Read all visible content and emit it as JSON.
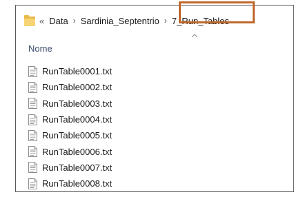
{
  "address_bar": {
    "overflow": "«",
    "path": [
      "Data",
      "Sardinia_Septentrio",
      "7_Run_Tables"
    ],
    "separator": "›"
  },
  "column_header": "Nome",
  "files": [
    {
      "name": "RunTable0001.txt"
    },
    {
      "name": "RunTable0002.txt"
    },
    {
      "name": "RunTable0003.txt"
    },
    {
      "name": "RunTable0004.txt"
    },
    {
      "name": "RunTable0005.txt"
    },
    {
      "name": "RunTable0006.txt"
    },
    {
      "name": "RunTable0007.txt"
    },
    {
      "name": "RunTable0008.txt"
    }
  ],
  "colors": {
    "highlight": "#c0672a",
    "folder": "#e9b949",
    "header_text": "#3b4a6b"
  },
  "icons": {
    "folder": "folder-icon",
    "file": "text-file-icon",
    "sort": "sort-up-caret-icon"
  }
}
